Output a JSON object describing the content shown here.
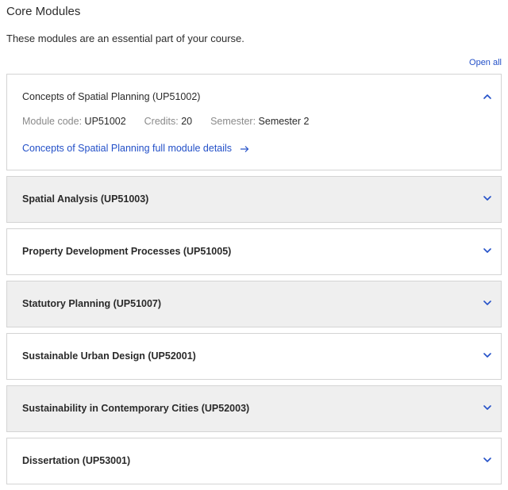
{
  "page": {
    "title": "Core Modules",
    "intro": "These modules are an essential part of your course.",
    "open_all_label": "Open all"
  },
  "expanded_module": {
    "title": "Concepts of Spatial Planning (UP51002)",
    "module_code_label": "Module code:",
    "module_code": "UP51002",
    "credits_label": "Credits:",
    "credits": "20",
    "semester_label": "Semester:",
    "semester": "Semester 2",
    "details_link": "Concepts of Spatial Planning full module details",
    "chevron_icon": "chevron-up-icon",
    "link_icon": "arrow-right-icon"
  },
  "modules": [
    {
      "title": "Spatial Analysis (UP51003)"
    },
    {
      "title": "Property Development Processes (UP51005)"
    },
    {
      "title": "Statutory Planning (UP51007)"
    },
    {
      "title": "Sustainable Urban Design (UP52001)"
    },
    {
      "title": "Sustainability in Contemporary Cities (UP52003)"
    },
    {
      "title": "Dissertation (UP53001)"
    }
  ],
  "colors": {
    "link": "#2350c8",
    "shaded_row": "#efefef",
    "border": "#d4d4d4"
  }
}
